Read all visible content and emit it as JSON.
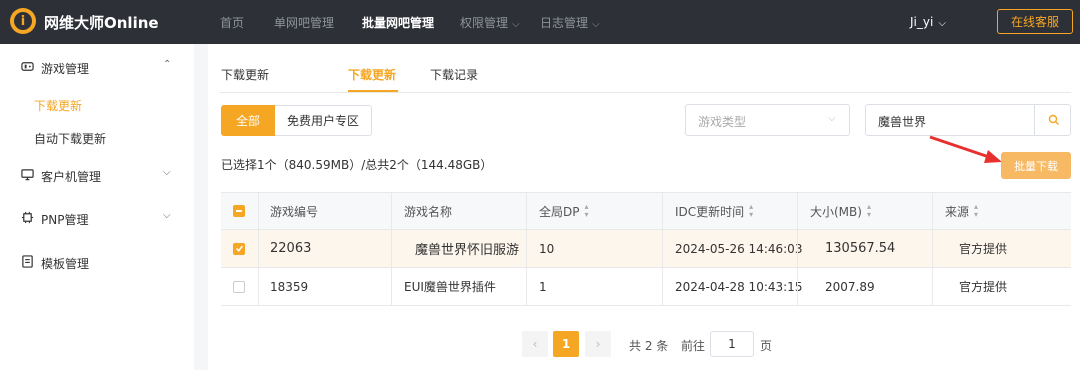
{
  "header": {
    "brand": "网维大师Online",
    "nav": [
      "首页",
      "单网吧管理",
      "批量网吧管理",
      "权限管理",
      "日志管理"
    ],
    "user": "Ji_yi",
    "service_button": "在线客服"
  },
  "sidebar": {
    "game_mgmt": "游戏管理",
    "sub_download_update": "下载更新",
    "sub_auto_update": "自动下载更新",
    "client_mgmt": "客户机管理",
    "pnp_mgmt": "PNP管理",
    "template_mgmt": "模板管理"
  },
  "tabs": [
    "下载更新",
    "下载更新",
    "下载记录"
  ],
  "filters": {
    "all": "全部",
    "free_zone": "免费用户专区",
    "game_type_placeholder": "游戏类型",
    "search_value": "魔兽世界"
  },
  "summary": "已选择1个（840.59MB）/总共2个（144.48GB）",
  "batch_download": "批量下载",
  "table": {
    "columns": [
      "游戏编号",
      "游戏名称",
      "全局DP",
      "IDC更新时间",
      "大小(MB)",
      "来源"
    ],
    "rows": [
      {
        "id": "22063",
        "name": "魔兽世界怀旧服游",
        "dp": "10",
        "time": "2024-05-26 14:46:03",
        "size": "130567.54",
        "source": "官方提供",
        "checked": true
      },
      {
        "id": "18359",
        "name": "EUI魔兽世界插件",
        "dp": "1",
        "time": "2024-04-28 10:43:15",
        "size": "2007.89",
        "source": "官方提供",
        "checked": false
      }
    ]
  },
  "pagination": {
    "current": "1",
    "total": "共 2 条",
    "goto": "前往",
    "page_input": "1",
    "page_suffix": "页"
  },
  "colors": {
    "accent": "#f5a623",
    "topbar": "#2d3037"
  }
}
